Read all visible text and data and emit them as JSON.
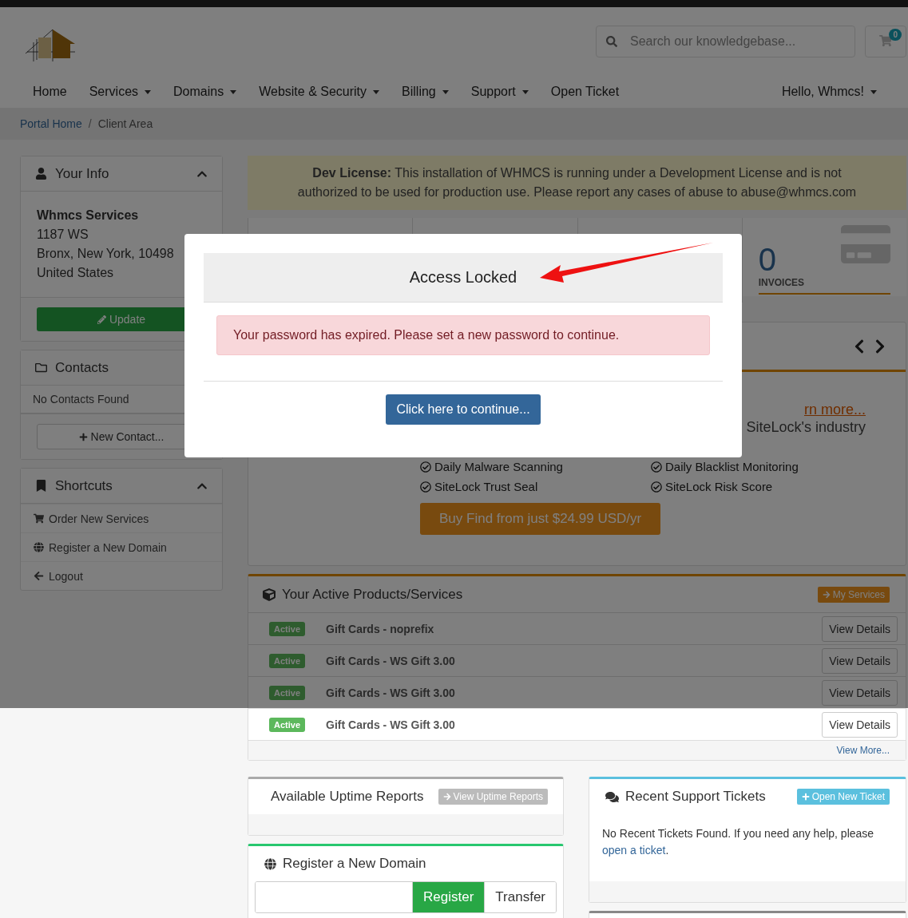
{
  "header": {
    "search": {
      "placeholder": "Search our knowledgebase..."
    },
    "cart_count": "0"
  },
  "nav": {
    "items": [
      {
        "label": "Home",
        "dropdown": false
      },
      {
        "label": "Services",
        "dropdown": true
      },
      {
        "label": "Domains",
        "dropdown": true
      },
      {
        "label": "Website & Security",
        "dropdown": true
      },
      {
        "label": "Billing",
        "dropdown": true
      },
      {
        "label": "Support",
        "dropdown": true
      },
      {
        "label": "Open Ticket",
        "dropdown": false
      }
    ],
    "user_menu": {
      "label": "Hello, Whmcs!",
      "dropdown": true
    }
  },
  "breadcrumb": {
    "separator": "/",
    "items": [
      {
        "label": "Portal Home",
        "selected": false
      },
      {
        "label": "Client Area",
        "selected": true
      }
    ]
  },
  "sidebar": {
    "your_info": {
      "title": "Your Info",
      "expanded": true,
      "name": "Whmcs Services",
      "address": [
        "1187 WS",
        "Bronx, New York, 10498",
        "United States"
      ],
      "button": "Update"
    },
    "contacts": {
      "title": "Contacts",
      "empty": "No Contacts Found",
      "button": "New Contact..."
    },
    "shortcuts": {
      "title": "Shortcuts",
      "expanded": true,
      "items": [
        "Order New Services",
        "Register a New Domain",
        "Logout"
      ]
    }
  },
  "dev_license": "**Dev License:** This installation of WHMCS is running under a Development License and is not authorized to be used for production use. Please report any cases of abuse to abuse@whmcs.com",
  "stats": [
    {
      "value": "0",
      "label": "INVOICES"
    }
  ],
  "promo": {
    "link": "rn more...",
    "text": "SiteLock's industry",
    "features": [
      "Daily Malware Scanning",
      "Daily Blacklist Monitoring",
      "SiteLock Trust Seal",
      "SiteLock Risk Score"
    ],
    "button": "Buy Find from just $24.99 USD/yr"
  },
  "products": {
    "title": "Your Active Products/Services",
    "button": "My Services",
    "rows": [
      {
        "status": "Active",
        "name": "Gift Cards - noprefix",
        "action": "View Details"
      },
      {
        "status": "Active",
        "name": "Gift Cards - WS Gift 3.00",
        "action": "View Details"
      },
      {
        "status": "Active",
        "name": "Gift Cards - WS Gift 3.00",
        "action": "View Details"
      },
      {
        "status": "Active",
        "name": "Gift Cards - WS Gift 3.00",
        "action": "View Details"
      }
    ],
    "footer": "View More..."
  },
  "uptime": {
    "title": "Available Uptime Reports",
    "button": "View Uptime Reports"
  },
  "domain": {
    "title": "Register a New Domain",
    "tabs": [
      {
        "label": "Register",
        "selected": true
      },
      {
        "label": "Transfer",
        "selected": false
      }
    ]
  },
  "tickets": {
    "title": "Recent Support Tickets",
    "button": "Open New Ticket",
    "text": "No Recent Tickets Found. If you need any help, please",
    "link": "open a ticket",
    "tail": "."
  },
  "modal": {
    "title": "Access Locked",
    "alert": "Your password has expired. Please set a new password to continue.",
    "button": "Click here to continue..."
  }
}
